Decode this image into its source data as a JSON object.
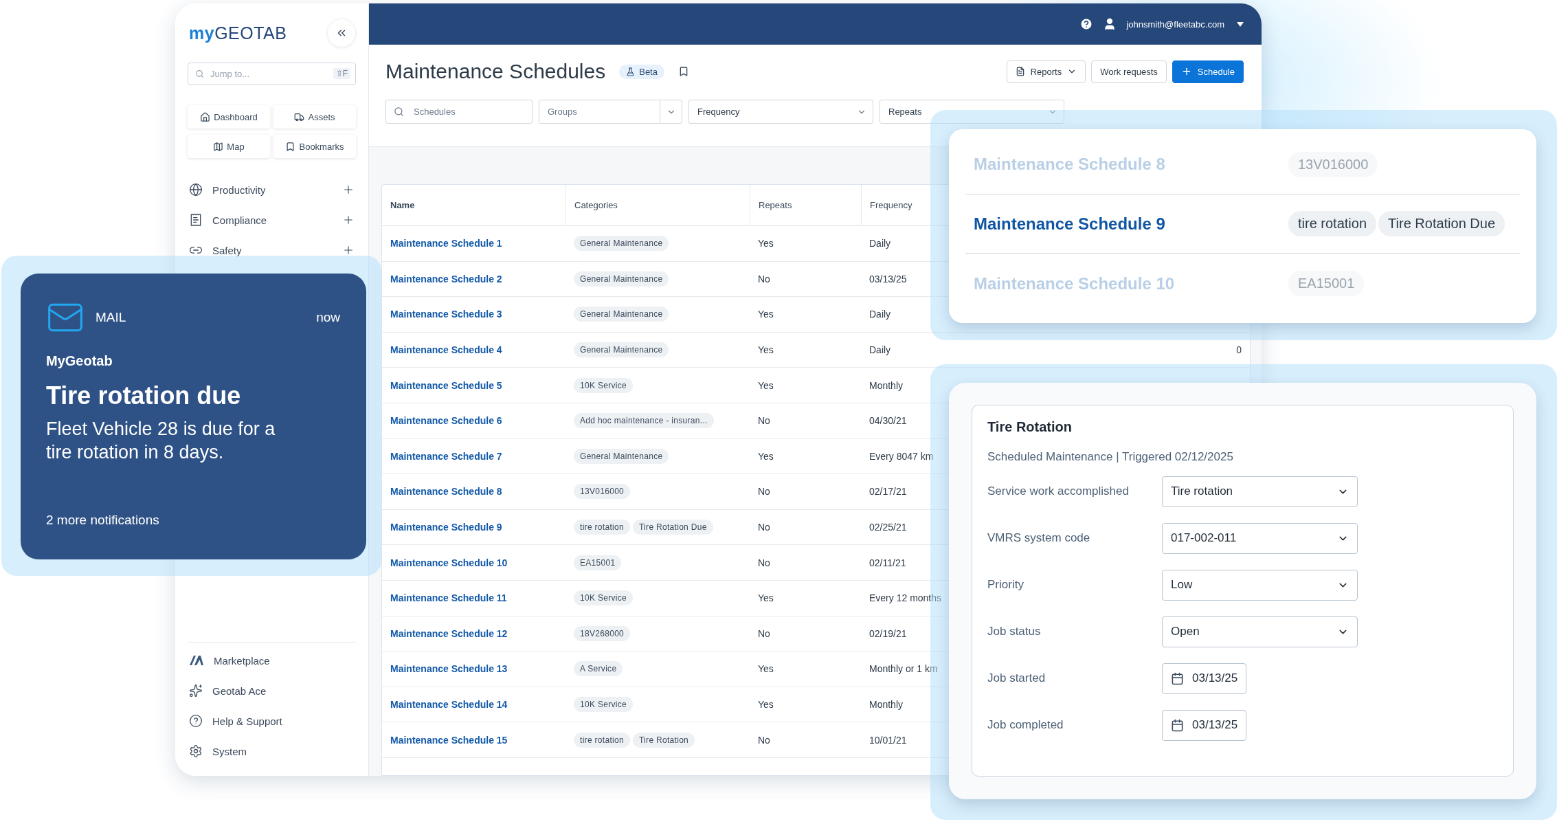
{
  "sidebar": {
    "logo": {
      "prefix": "my",
      "name": "GEOTAB"
    },
    "search": {
      "placeholder": "Jump to...",
      "shortcut": "⇧F"
    },
    "quick_links": [
      {
        "label": "Dashboard"
      },
      {
        "label": "Assets"
      },
      {
        "label": "Map"
      },
      {
        "label": "Bookmarks"
      }
    ],
    "nav": [
      {
        "label": "Productivity"
      },
      {
        "label": "Compliance"
      },
      {
        "label": "Safety"
      }
    ],
    "footer_nav": [
      {
        "label": "Marketplace"
      },
      {
        "label": "Geotab Ace"
      },
      {
        "label": "Help & Support"
      },
      {
        "label": "System"
      }
    ]
  },
  "topbar": {
    "user": "johnsmith@fleetabc.com"
  },
  "page": {
    "title": "Maintenance Schedules",
    "badge": "Beta",
    "actions": [
      {
        "label": "Reports",
        "kind": "menu"
      },
      {
        "label": "Work requests",
        "kind": "plain"
      },
      {
        "label": "Schedule",
        "kind": "primary"
      }
    ]
  },
  "filters": [
    {
      "kind": "search",
      "placeholder": "Schedules"
    },
    {
      "kind": "split",
      "placeholder": "Groups"
    },
    {
      "kind": "select",
      "value": "Frequency"
    },
    {
      "kind": "select",
      "value": "Repeats"
    }
  ],
  "table": {
    "columns": [
      "Name",
      "Categories",
      "Repeats",
      "Frequency"
    ],
    "rows": [
      {
        "name": "Maintenance Schedule 1",
        "categories": [
          "General Maintenance"
        ],
        "repeats": "Yes",
        "frequency": "Daily"
      },
      {
        "name": "Maintenance Schedule 2",
        "categories": [
          "General Maintenance"
        ],
        "repeats": "No",
        "frequency": "03/13/25"
      },
      {
        "name": "Maintenance Schedule 3",
        "categories": [
          "General Maintenance"
        ],
        "repeats": "Yes",
        "frequency": "Daily"
      },
      {
        "name": "Maintenance Schedule 4",
        "categories": [
          "General Maintenance"
        ],
        "repeats": "Yes",
        "frequency": "Daily",
        "column_5": "0"
      },
      {
        "name": "Maintenance Schedule 5",
        "categories": [
          "10K Service"
        ],
        "repeats": "Yes",
        "frequency": "Monthly"
      },
      {
        "name": "Maintenance Schedule 6",
        "categories": [
          "Add hoc maintenance - insuran..."
        ],
        "repeats": "No",
        "frequency": "04/30/21"
      },
      {
        "name": "Maintenance Schedule 7",
        "categories": [
          "General Maintenance"
        ],
        "repeats": "Yes",
        "frequency": "Every 8047 km"
      },
      {
        "name": "Maintenance Schedule 8",
        "categories": [
          "13V016000"
        ],
        "repeats": "No",
        "frequency": "02/17/21"
      },
      {
        "name": "Maintenance Schedule 9",
        "categories": [
          "tire rotation",
          "Tire Rotation Due"
        ],
        "repeats": "No",
        "frequency": "02/25/21"
      },
      {
        "name": "Maintenance Schedule 10",
        "categories": [
          "EA15001"
        ],
        "repeats": "No",
        "frequency": "02/11/21"
      },
      {
        "name": "Maintenance Schedule 11",
        "categories": [
          "10K Service"
        ],
        "repeats": "Yes",
        "frequency": "Every 12 months"
      },
      {
        "name": "Maintenance Schedule 12",
        "categories": [
          "18V268000"
        ],
        "repeats": "No",
        "frequency": "02/19/21"
      },
      {
        "name": "Maintenance Schedule 13",
        "categories": [
          "A Service"
        ],
        "repeats": "Yes",
        "frequency": "Monthly or 1 km"
      },
      {
        "name": "Maintenance Schedule 14",
        "categories": [
          "10K Service"
        ],
        "repeats": "Yes",
        "frequency": "Monthly"
      },
      {
        "name": "Maintenance Schedule 15",
        "categories": [
          "tire rotation",
          "Tire Rotation"
        ],
        "repeats": "No",
        "frequency": "10/01/21"
      }
    ]
  },
  "notification": {
    "app": "MAIL",
    "time": "now",
    "sender": "MyGeotab",
    "title": "Tire rotation due",
    "body": "Fleet Vehicle 28 is due for a tire rotation in 8 days.",
    "footer": "2 more notifications"
  },
  "search_popup": {
    "rows": [
      {
        "name": "Maintenance Schedule 8",
        "tags": [
          "13V016000"
        ],
        "selected": false
      },
      {
        "name": "Maintenance Schedule 9",
        "tags": [
          "tire rotation",
          "Tire Rotation Due"
        ],
        "selected": true
      },
      {
        "name": "Maintenance Schedule 10",
        "tags": [
          "EA15001"
        ],
        "selected": false
      }
    ]
  },
  "work_order": {
    "title": "Tire Rotation",
    "subtitle": "Scheduled Maintenance | Triggered 02/12/2025",
    "fields": [
      {
        "label": "Service work accomplished",
        "kind": "select",
        "value": "Tire rotation"
      },
      {
        "label": "VMRS system code",
        "kind": "select",
        "value": "017-002-011"
      },
      {
        "label": "Priority",
        "kind": "select",
        "value": "Low"
      },
      {
        "label": "Job status",
        "kind": "select",
        "value": "Open"
      },
      {
        "label": "Job started",
        "kind": "date",
        "value": "03/13/25"
      },
      {
        "label": "Job completed",
        "kind": "date",
        "value": "03/13/25"
      }
    ]
  }
}
